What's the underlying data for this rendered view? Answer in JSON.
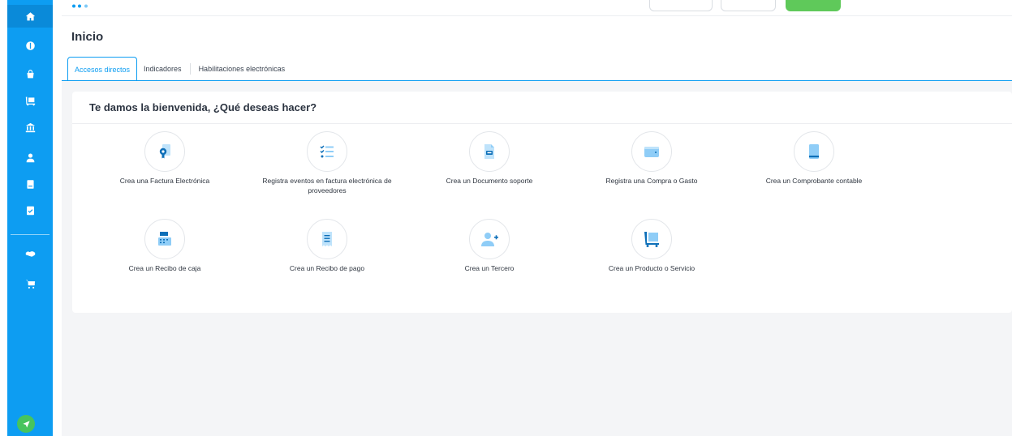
{
  "app": {
    "brand_color": "#0d9df2",
    "accent_green": "#47c45d"
  },
  "sidebar": {
    "items": [
      {
        "name": "home",
        "icon": "home-icon",
        "active": true
      },
      {
        "name": "ingresos",
        "icon": "money-icon"
      },
      {
        "name": "gastos",
        "icon": "shopping-bag-icon"
      },
      {
        "name": "inventario",
        "icon": "cart-dolly-icon"
      },
      {
        "name": "bancos",
        "icon": "bank-icon"
      },
      {
        "name": "contactos",
        "icon": "user-icon"
      },
      {
        "name": "contabilidad",
        "icon": "book-icon"
      },
      {
        "name": "reportes",
        "icon": "clipboard-check-icon"
      },
      {
        "name": "alianzas",
        "icon": "handshake-icon"
      },
      {
        "name": "tienda",
        "icon": "shopping-cart-icon"
      }
    ],
    "footer_icon": "rocket-icon"
  },
  "header": {
    "title": "Inicio",
    "tabs": [
      {
        "label": "Accesos directos",
        "active": true
      },
      {
        "label": "Indicadores",
        "active": false
      },
      {
        "label": "Habilitaciones electrónicas",
        "active": false
      }
    ]
  },
  "welcome": {
    "title": "Te damos la bienvenida, ¿Qué deseas hacer?",
    "actions": [
      {
        "label": "Crea una Factura Electrónica",
        "icon": "invoice-certificate-icon"
      },
      {
        "label": "Registra eventos en factura electrónica de proveedores",
        "icon": "checklist-icon"
      },
      {
        "label": "Crea un Documento soporte",
        "icon": "support-document-icon"
      },
      {
        "label": "Registra una Compra o Gasto",
        "icon": "wallet-icon"
      },
      {
        "label": "Crea un Comprobante contable",
        "icon": "ledger-book-icon"
      },
      {
        "label": "Crea un Recibo de caja",
        "icon": "cash-register-icon"
      },
      {
        "label": "Crea un Recibo de pago",
        "icon": "receipt-icon"
      },
      {
        "label": "Crea un Tercero",
        "icon": "add-user-icon"
      },
      {
        "label": "Crea un Producto o Servicio",
        "icon": "product-cart-icon"
      }
    ]
  }
}
